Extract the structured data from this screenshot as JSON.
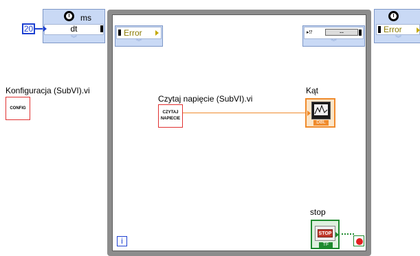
{
  "constants": {
    "dt_value": "20"
  },
  "wait_node_left": {
    "unit": "ms",
    "input_label": "dt"
  },
  "wait_node_right": {
    "unit": ""
  },
  "error_cluster_in": {
    "label": "Error"
  },
  "error_cluster_right": {
    "label": "Error"
  },
  "shift_register_out": {
    "label": "--"
  },
  "subvis": {
    "config": {
      "name": "Konfiguracja (SubVI).vi",
      "icon_text": "CONFIG"
    },
    "read_voltage": {
      "name": "Czytaj napięcie (SubVI).vi",
      "icon_text_line1": "CZYTAJ",
      "icon_text_line2": "NAPIECIE"
    }
  },
  "indicators": {
    "angle": {
      "label": "Kąt",
      "type_badge": "DBL"
    },
    "stop": {
      "label": "stop",
      "button_text": "STOP",
      "type_badge": "TF"
    }
  },
  "loop": {
    "iteration_terminal": "i"
  },
  "colors": {
    "loop_border": "#8c8c8c",
    "express_node": "#c9d9f5",
    "numeric_wire": "#f08b2c",
    "int_wire": "#1c3fd1",
    "bool_wire": "#1e8a2e",
    "error_text": "#8a7a00",
    "subvi_border": "#e03030"
  }
}
